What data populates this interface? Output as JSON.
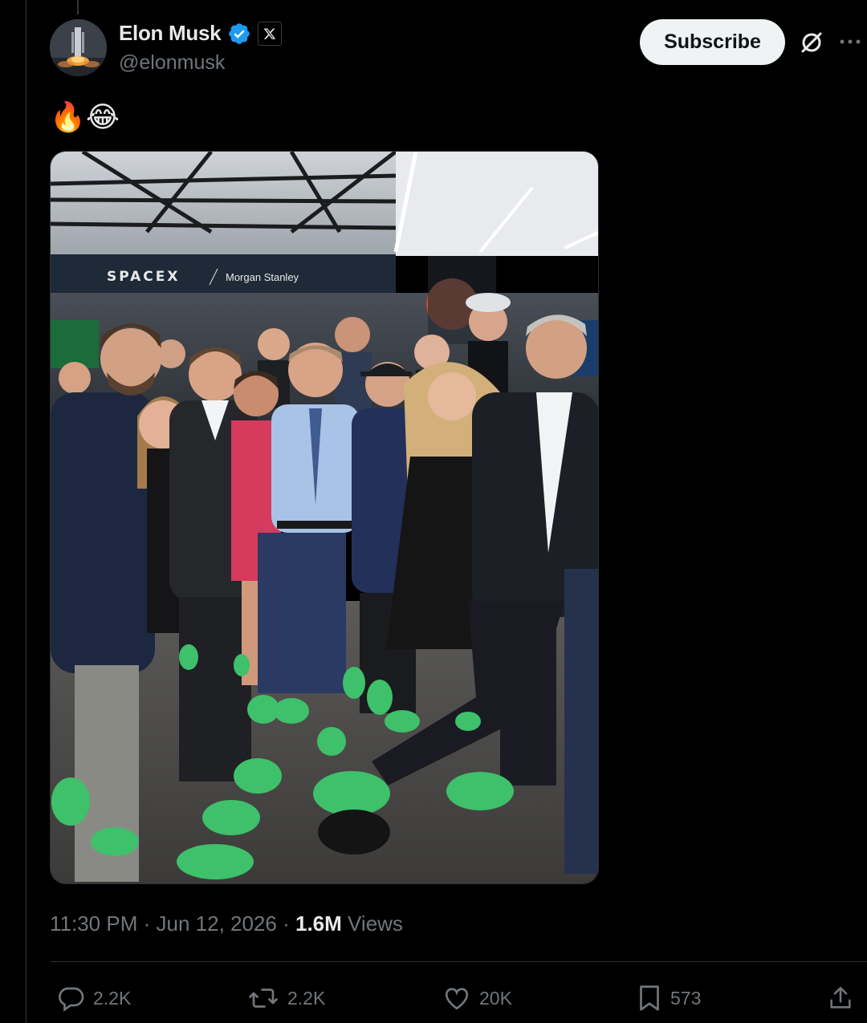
{
  "author": {
    "display_name": "Elon Musk",
    "handle": "@elonmusk",
    "verified": true,
    "affiliation_badge": "x-logo-icon"
  },
  "header_actions": {
    "subscribe_label": "Subscribe",
    "grok_icon": "grok-icon",
    "more_icon": "more-icon"
  },
  "post": {
    "text": "🔥😂",
    "media": {
      "type": "photo",
      "signage": [
        "SPACEX",
        "Morgan Stanley"
      ]
    }
  },
  "meta": {
    "time": "11:30 PM",
    "separator": "·",
    "date": "Jun 12, 2026",
    "views_count": "1.6M",
    "views_label": "Views"
  },
  "actions": {
    "replies": "2.2K",
    "reposts": "2.2K",
    "likes": "20K",
    "bookmarks": "573"
  },
  "colors": {
    "background": "#000000",
    "text_primary": "#e7e9ea",
    "text_secondary": "#71767b",
    "verified_blue": "#1d9bf0",
    "border": "#2f3336",
    "shoe_green": "#3fc06a"
  }
}
